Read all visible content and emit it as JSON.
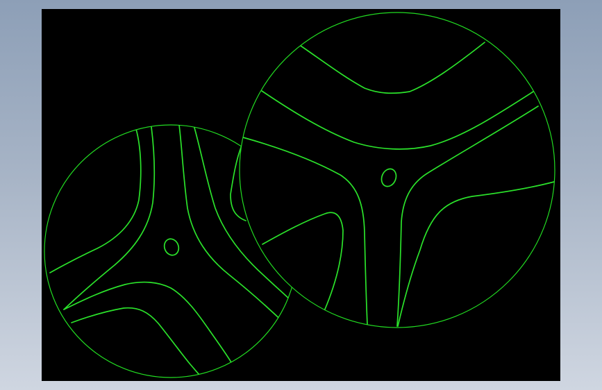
{
  "colors": {
    "background_top": "#8d9fb7",
    "background_bottom": "#cfd6e1",
    "viewport": "#000000",
    "circle_outline": "#22dd22",
    "curve": "#2be32b"
  }
}
